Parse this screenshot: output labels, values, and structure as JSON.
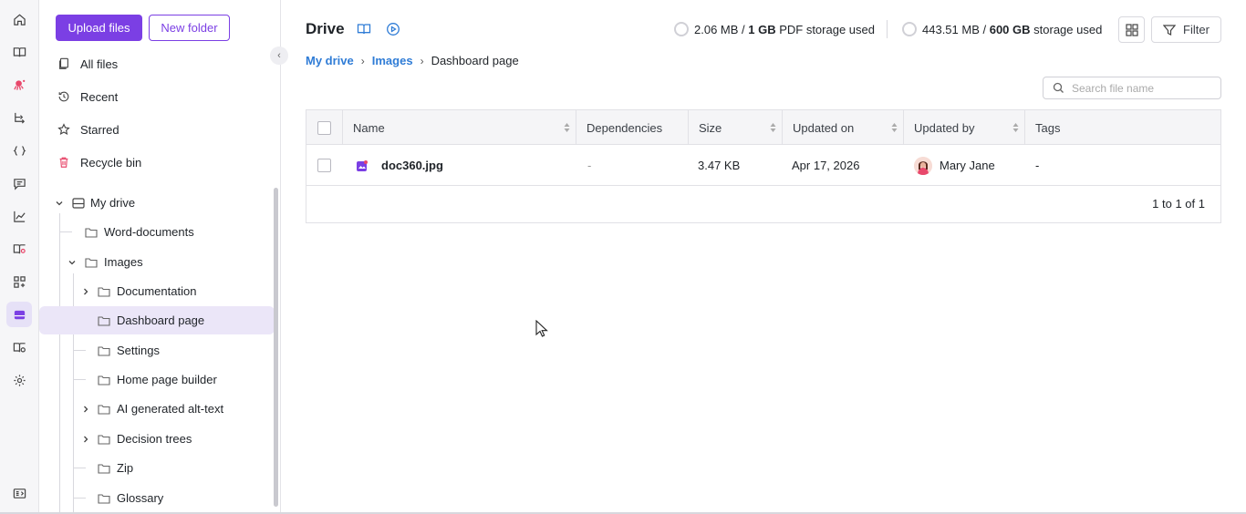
{
  "colors": {
    "accent": "#7b3fe4",
    "link": "#2f7cd6",
    "selected_bg": "#ebe6f8"
  },
  "rail": {
    "icons": [
      "home-icon",
      "book-icon",
      "octopus-icon",
      "workflow-icon",
      "code-icon",
      "comment-icon",
      "analytics-icon",
      "knowledge-icon",
      "apps-icon",
      "drive-icon",
      "settings-book-icon",
      "gear-icon",
      "panel-toggle-icon"
    ],
    "active": "drive-icon"
  },
  "sidebar": {
    "upload_label": "Upload files",
    "new_folder_label": "New folder",
    "nav": [
      {
        "label": "All files",
        "icon": "files-icon"
      },
      {
        "label": "Recent",
        "icon": "history-icon"
      },
      {
        "label": "Starred",
        "icon": "star-icon"
      },
      {
        "label": "Recycle bin",
        "icon": "trash-icon"
      }
    ],
    "tree": {
      "root": "My drive",
      "items": [
        {
          "label": "Word-documents"
        },
        {
          "label": "Images"
        },
        {
          "label": "Documentation"
        },
        {
          "label": "Dashboard page"
        },
        {
          "label": "Settings"
        },
        {
          "label": "Home page builder"
        },
        {
          "label": "AI generated alt-text"
        },
        {
          "label": "Decision trees"
        },
        {
          "label": "Zip"
        },
        {
          "label": "Glossary"
        }
      ]
    }
  },
  "header": {
    "title": "Drive",
    "pdf_storage": {
      "used": "2.06 MB / ",
      "total": "1 GB",
      "suffix": " PDF storage used"
    },
    "storage": {
      "used": "443.51 MB / ",
      "total": "600 GB",
      "suffix": " storage used"
    },
    "filter_label": "Filter"
  },
  "breadcrumb": {
    "items": [
      "My drive",
      "Images",
      "Dashboard page"
    ]
  },
  "search": {
    "placeholder": "Search file name"
  },
  "table": {
    "columns": [
      "Name",
      "Dependencies",
      "Size",
      "Updated on",
      "Updated by",
      "Tags"
    ],
    "rows": [
      {
        "name": "doc360.jpg",
        "dependencies": "-",
        "size": "3.47 KB",
        "updated_on": "Apr 17, 2026",
        "updated_by": "Mary Jane",
        "tags": "-"
      }
    ],
    "pagination": "1 to 1 of 1"
  }
}
